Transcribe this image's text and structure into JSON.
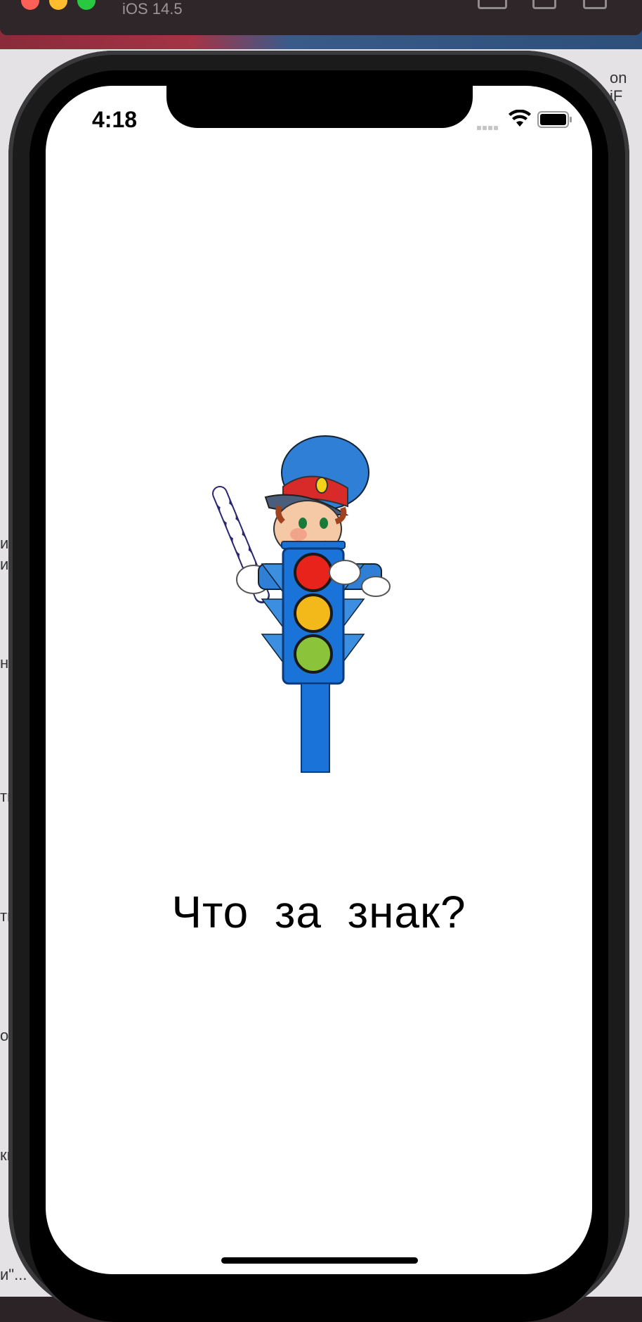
{
  "simulator": {
    "subtitle": "iOS 14.5"
  },
  "status_bar": {
    "time": "4:18"
  },
  "main": {
    "title": "Что за знак?"
  },
  "illustration": {
    "icon": "traffic-light-cartoon-policeman",
    "light_colors": [
      "#e8231b",
      "#f3b81a",
      "#8bc43a"
    ],
    "body_color": "#1a73d9"
  },
  "background": {
    "fragments": [
      "on iF",
      "ия",
      "ил",
      "ня",
      "ти",
      "ти",
      "ор",
      "ки",
      "и\"..."
    ]
  }
}
